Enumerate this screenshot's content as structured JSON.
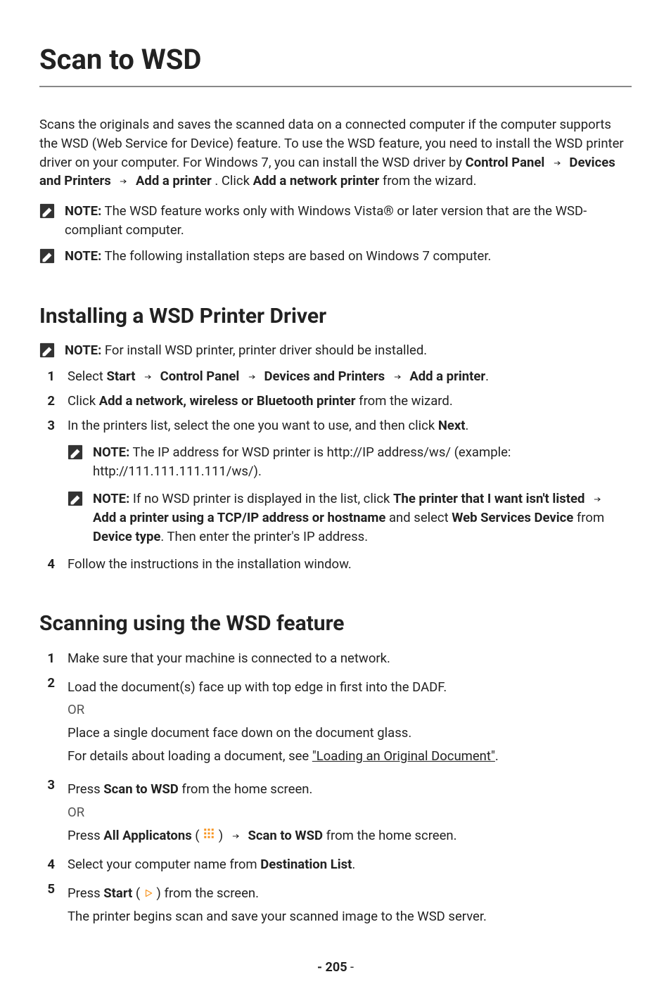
{
  "title": "Scan to WSD",
  "intro": {
    "pre": "Scans the originals and saves the scanned data on a connected computer if the computer supports the WSD (Web Service for Device) feature. To use the WSD feature, you need to install the WSD printer driver on your computer. For Windows 7, you can install the WSD driver by ",
    "b1": "Control Panel",
    "b2": "Devices and Printers",
    "b3": "Add a printer",
    "mid": ". Click ",
    "b4": "Add a network printer",
    "post": " from the wizard."
  },
  "notes_top": {
    "n1_label": "NOTE:",
    "n1_text": " The WSD feature works only with Windows Vista® or later version that are the WSD-compliant computer.",
    "n2_label": "NOTE:",
    "n2_text": " The following installation steps are based on Windows 7 computer."
  },
  "section1": {
    "heading": "Installing a WSD Printer Driver",
    "note_label": "NOTE:",
    "note_text": " For install WSD printer, printer driver should be installed.",
    "step1": {
      "pre": "Select ",
      "b1": "Start",
      "b2": "Control Panel",
      "b3": "Devices and Printers",
      "b4": "Add a printer",
      "post": "."
    },
    "step2": {
      "pre": "Click ",
      "b1": "Add a network, wireless or Bluetooth printer",
      "post": " from the wizard."
    },
    "step3": {
      "pre": "In the printers list, select the one you want to use, and then click ",
      "b1": "Next",
      "post": ".",
      "sub1_label": "NOTE:",
      "sub1_text": " The IP address for WSD printer is http://IP address/ws/ (example: http://111.111.111.111/ws/).",
      "sub2_label": "NOTE:",
      "sub2_pre": " If no WSD printer is displayed in the list, click ",
      "sub2_b1": "The printer that I want isn't listed",
      "sub2_b2": "Add a printer using a TCP/IP address or hostname",
      "sub2_mid": " and select ",
      "sub2_b3": "Web Services Device",
      "sub2_from": " from ",
      "sub2_b4": "Device type",
      "sub2_post": ". Then enter the printer's IP address."
    },
    "step4": "Follow the instructions in the installation window."
  },
  "section2": {
    "heading": "Scanning using the WSD feature",
    "step1": "Make sure that your machine is connected to a network.",
    "step2_a": "Load the document(s) face up with top edge in first into the DADF.",
    "step2_or": "OR",
    "step2_b": "Place a single document face down on the document glass.",
    "step2_c_pre": "For details about loading a document, see ",
    "step2_c_link": "\"Loading an Original Document\"",
    "step2_c_post": ".",
    "step3_a_pre": "Press ",
    "step3_a_b": "Scan to WSD",
    "step3_a_post": " from the home screen.",
    "step3_or": "OR",
    "step3_b_pre": "Press ",
    "step3_b_b1": "All Applicatons",
    "step3_b_paren_open": " ( ",
    "step3_b_paren_close": " ) ",
    "step3_b_b2": "Scan to WSD",
    "step3_b_post": " from the home screen.",
    "step4_pre": "Select your computer name from ",
    "step4_b": "Destination List",
    "step4_post": ".",
    "step5_pre": "Press ",
    "step5_b": "Start",
    "step5_paren_open": " ( ",
    "step5_paren_close": " ) ",
    "step5_post": "from the screen.",
    "step5_extra": "The printer begins scan and save your scanned image to the WSD server."
  },
  "page": {
    "num": "- 205",
    "suffix": " -"
  }
}
